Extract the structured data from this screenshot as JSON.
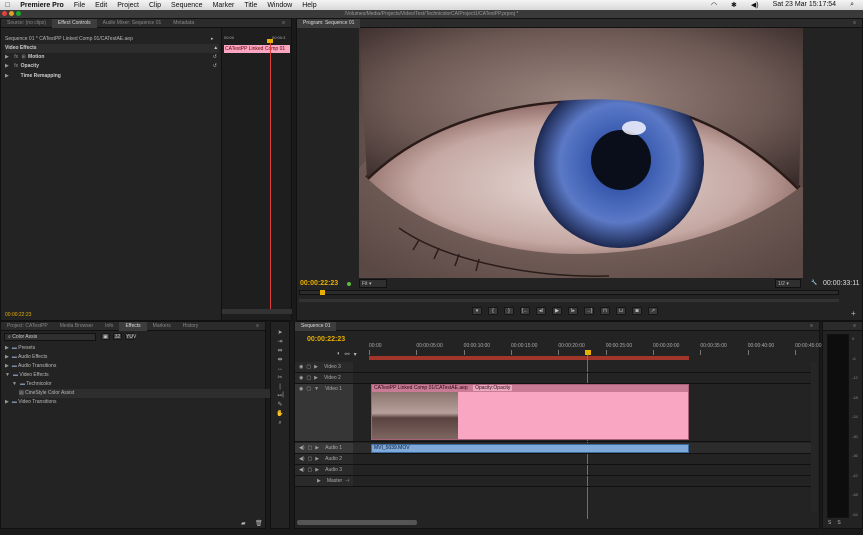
{
  "menubar": {
    "app": "Premiere Pro",
    "items": [
      "File",
      "Edit",
      "Project",
      "Clip",
      "Sequence",
      "Marker",
      "Title",
      "Window",
      "Help"
    ],
    "clock": "Sat 23 Mar  15:17:54"
  },
  "titlebar": {
    "path": "/Volumes/Media/Projects/Video/Test/TechnicolorCA/Project1/CATestPP.prproj *"
  },
  "colors": {
    "accent": "#e8b000",
    "clip_pink": "#f9a6c3",
    "audio_blue": "#7ea9d9",
    "playhead": "#e04040"
  },
  "effect_controls": {
    "tabs": [
      "Source: (no clips)",
      "Effect Controls",
      "Audio Mixer: Sequence 01",
      "Metadata"
    ],
    "active_tab": 1,
    "header": "Sequence 01 * CATestPP Linked Comp 01/CATestAE.aep",
    "ruler_start": "00:00",
    "ruler_end": "00:00:3",
    "clip_label": "CATestPP Linked Comp 01",
    "section": "Video Effects",
    "rows": [
      {
        "label": "Motion",
        "icon": "fx-motion-icon"
      },
      {
        "label": "Opacity",
        "icon": "fx-icon"
      },
      {
        "label": "Time Remapping",
        "icon": ""
      }
    ],
    "timecode": "00:00:22:23"
  },
  "program": {
    "tabs": [
      "Program: Sequence 01"
    ],
    "timecode": "00:00:22:23",
    "fit": "Fit",
    "resolution": "1/2",
    "duration": "00:00:33:11"
  },
  "project": {
    "tabs": [
      "Project: CATestPP",
      "Media Browser",
      "Info",
      "Effects",
      "Markers",
      "History"
    ],
    "active_tab": 3,
    "search": "Color Assis",
    "tree": [
      {
        "label": "Presets",
        "indent": 0,
        "folder": true
      },
      {
        "label": "Audio Effects",
        "indent": 0,
        "folder": true
      },
      {
        "label": "Audio Transitions",
        "indent": 0,
        "folder": true
      },
      {
        "label": "Video Effects",
        "indent": 0,
        "folder": true,
        "open": true
      },
      {
        "label": "Technicolor",
        "indent": 1,
        "folder": true,
        "open": true
      },
      {
        "label": "CineStyle Color Assist",
        "indent": 2,
        "folder": false
      },
      {
        "label": "Video Transitions",
        "indent": 0,
        "folder": true
      }
    ]
  },
  "timeline": {
    "tabs": [
      "Sequence 01"
    ],
    "timecode": "00:00:22:23",
    "ruler": [
      "00:00",
      "00:00:05:00",
      "00:00:10:00",
      "00:00:15:00",
      "00:00:20:00",
      "00:00:25:00",
      "00:00:30:00",
      "00:00:35:00",
      "00:00:40:00",
      "00:00:45:00"
    ],
    "tracks": {
      "video": [
        "Video 3",
        "Video 2",
        "Video 1"
      ],
      "audio": [
        "Audio 1",
        "Audio 2",
        "Audio 3"
      ],
      "master": "Master"
    },
    "video_clip": "CATestPP Linked Comp 01/CATestAE.aep",
    "video_clip_fx": "Opacity:Opacity",
    "audio_clip": "MVI_5039.MOV"
  },
  "meter": {
    "scale": [
      "0",
      "-6",
      "-12",
      "-18",
      "-24",
      "-30",
      "-36",
      "-42",
      "-48",
      "-54"
    ]
  },
  "chart_data": null
}
